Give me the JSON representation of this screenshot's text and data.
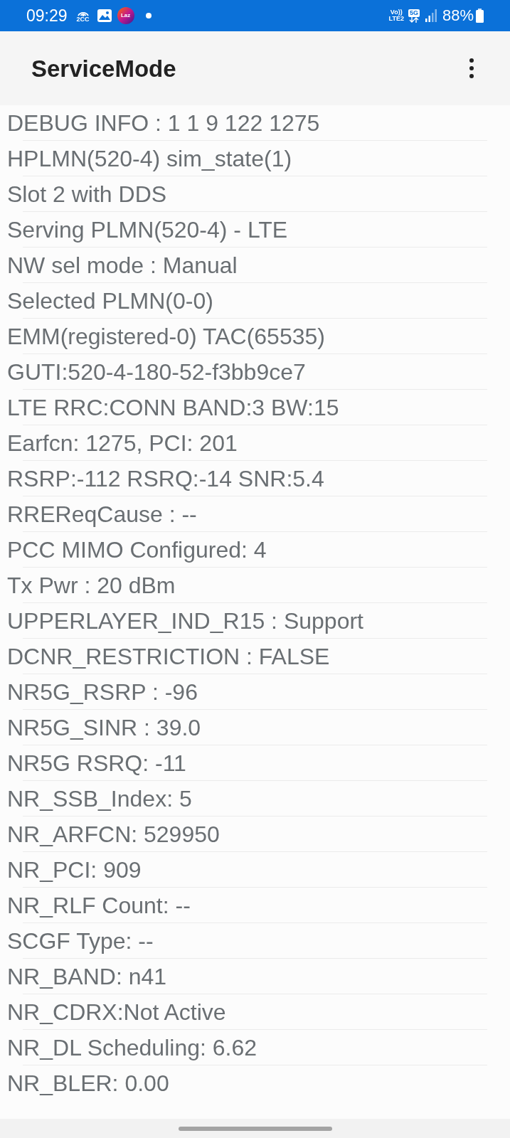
{
  "status_bar": {
    "time": "09:29",
    "hotspot_label": "2CC",
    "app_label": "Laz",
    "volte_label": "Vo))",
    "volte_sub": "LTE2",
    "network_label": "5G",
    "battery": "88%"
  },
  "app_bar": {
    "title": "ServiceMode"
  },
  "rows": [
    "DEBUG INFO : 1 1 9 122 1275",
    "HPLMN(520-4) sim_state(1)",
    "Slot 2 with DDS",
    "Serving PLMN(520-4) - LTE",
    "NW sel mode : Manual",
    "Selected PLMN(0-0)",
    "EMM(registered-0) TAC(65535)",
    "GUTI:520-4-180-52-f3bb9ce7",
    "LTE RRC:CONN BAND:3 BW:15",
    "Earfcn: 1275, PCI: 201",
    "RSRP:-112 RSRQ:-14 SNR:5.4",
    "RREReqCause : --",
    "PCC MIMO Configured: 4",
    "Tx Pwr : 20 dBm",
    "UPPERLAYER_IND_R15 : Support",
    "DCNR_RESTRICTION : FALSE",
    "NR5G_RSRP : -96",
    "NR5G_SINR : 39.0",
    "NR5G RSRQ: -11",
    "NR_SSB_Index: 5",
    "NR_ARFCN: 529950",
    "NR_PCI: 909",
    "NR_RLF Count: --",
    "SCGF Type: --",
    "NR_BAND: n41",
    "NR_CDRX:Not Active",
    "NR_DL Scheduling: 6.62",
    "NR_BLER: 0.00"
  ]
}
